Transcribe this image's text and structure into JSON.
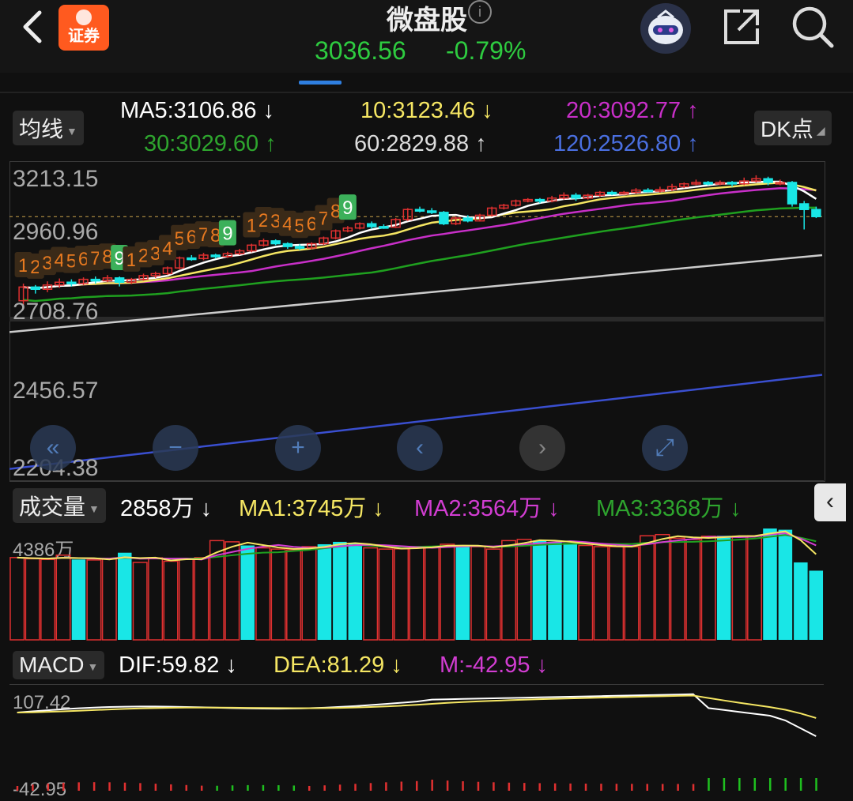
{
  "header": {
    "title": "微盘股",
    "price": "3036.56",
    "change_pct": "-0.79%",
    "logo_text": "证券"
  },
  "ma_chip": "均线",
  "dk_chip": "DK点",
  "ma": {
    "ma5": "MA5:3106.86 ↓",
    "ma10": "10:3123.46 ↓",
    "ma20": "20:3092.77 ↑",
    "ma30": "30:3029.60 ↑",
    "ma60": "60:2829.88 ↑",
    "ma120": "120:2526.80 ↑"
  },
  "yaxis": [
    "3213.15",
    "2960.96",
    "2708.76",
    "2456.57",
    "2204.38"
  ],
  "volume": {
    "chip": "成交量",
    "value": "2858万 ↓",
    "ma1": "MA1:3745万 ↓",
    "ma2": "MA2:3564万 ↓",
    "ma3": "MA3:3368万 ↓",
    "ymax": "4386万"
  },
  "macd": {
    "chip": "MACD",
    "dif": "DIF:59.82 ↓",
    "dea": "DEA:81.29 ↓",
    "m": "M:-42.95 ↓",
    "ymax": "107.42",
    "ymin": "-42.95"
  },
  "colors": {
    "up": "#e03030",
    "down": "#19e6e6",
    "ma5": "#ffffff",
    "ma10": "#f5e663",
    "ma20": "#c82fc8",
    "ma30": "#1fa01f",
    "ma60": "#cccccc",
    "ma120": "#3a4fd0",
    "td_up": "#e87a20",
    "td_down": "#3cb05a"
  },
  "candles": [
    [
      2790,
      2838,
      2775,
      2850
    ],
    [
      2838,
      2830,
      2815,
      2845
    ],
    [
      2830,
      2845,
      2820,
      2858
    ],
    [
      2845,
      2855,
      2835,
      2868
    ],
    [
      2855,
      2850,
      2840,
      2865
    ],
    [
      2850,
      2865,
      2845,
      2872
    ],
    [
      2865,
      2860,
      2850,
      2875
    ],
    [
      2860,
      2870,
      2855,
      2880
    ],
    [
      2870,
      2855,
      2840,
      2875
    ],
    [
      2855,
      2865,
      2848,
      2870
    ],
    [
      2865,
      2878,
      2860,
      2885
    ],
    [
      2878,
      2885,
      2870,
      2892
    ],
    [
      2885,
      2905,
      2880,
      2910
    ],
    [
      2905,
      2940,
      2900,
      2945
    ],
    [
      2940,
      2938,
      2930,
      2950
    ],
    [
      2938,
      2950,
      2932,
      2958
    ],
    [
      2950,
      2945,
      2938,
      2955
    ],
    [
      2945,
      2955,
      2940,
      2962
    ],
    [
      2955,
      2965,
      2950,
      2972
    ],
    [
      2965,
      2985,
      2960,
      2990
    ],
    [
      2985,
      3000,
      2980,
      3008
    ],
    [
      3000,
      2990,
      2985,
      3005
    ],
    [
      2990,
      2980,
      2972,
      2995
    ],
    [
      2980,
      2975,
      2968,
      2988
    ],
    [
      2975,
      2990,
      2970,
      2995
    ],
    [
      2990,
      3010,
      2985,
      3015
    ],
    [
      3010,
      3035,
      3005,
      3040
    ],
    [
      3035,
      3045,
      3030,
      3052
    ],
    [
      3045,
      3060,
      3040,
      3065
    ],
    [
      3060,
      3050,
      3042,
      3068
    ],
    [
      3050,
      3048,
      3042,
      3058
    ],
    [
      3048,
      3075,
      3045,
      3080
    ],
    [
      3075,
      3110,
      3070,
      3115
    ],
    [
      3110,
      3105,
      3100,
      3120
    ],
    [
      3105,
      3100,
      3094,
      3115
    ],
    [
      3100,
      3060,
      3055,
      3105
    ],
    [
      3060,
      3080,
      3055,
      3085
    ],
    [
      3080,
      3070,
      3065,
      3090
    ],
    [
      3070,
      3090,
      3068,
      3095
    ],
    [
      3090,
      3115,
      3085,
      3120
    ],
    [
      3115,
      3125,
      3110,
      3130
    ],
    [
      3125,
      3140,
      3120,
      3145
    ],
    [
      3140,
      3145,
      3135,
      3150
    ],
    [
      3145,
      3140,
      3132,
      3150
    ],
    [
      3140,
      3150,
      3135,
      3158
    ],
    [
      3150,
      3160,
      3145,
      3170
    ],
    [
      3160,
      3150,
      3140,
      3168
    ],
    [
      3150,
      3160,
      3145,
      3165
    ],
    [
      3160,
      3170,
      3155,
      3175
    ],
    [
      3170,
      3165,
      3160,
      3176
    ],
    [
      3165,
      3170,
      3162,
      3175
    ],
    [
      3170,
      3178,
      3165,
      3185
    ],
    [
      3178,
      3175,
      3170,
      3185
    ],
    [
      3175,
      3180,
      3170,
      3190
    ],
    [
      3180,
      3190,
      3175,
      3200
    ],
    [
      3190,
      3200,
      3185,
      3205
    ],
    [
      3200,
      3205,
      3195,
      3215
    ],
    [
      3205,
      3200,
      3195,
      3210
    ],
    [
      3200,
      3205,
      3195,
      3212
    ],
    [
      3205,
      3200,
      3190,
      3210
    ],
    [
      3200,
      3210,
      3195,
      3222
    ],
    [
      3210,
      3218,
      3205,
      3230
    ],
    [
      3218,
      3205,
      3195,
      3225
    ],
    [
      3205,
      3205,
      3195,
      3215
    ],
    [
      3205,
      3130,
      3120,
      3210
    ],
    [
      3130,
      3110,
      3040,
      3140
    ],
    [
      3110,
      3085,
      3080,
      3120
    ]
  ],
  "td_labels": [
    {
      "i": 0,
      "n": "1",
      "t": "up"
    },
    {
      "i": 1,
      "n": "2",
      "t": "up"
    },
    {
      "i": 2,
      "n": "3",
      "t": "up"
    },
    {
      "i": 3,
      "n": "4",
      "t": "up"
    },
    {
      "i": 4,
      "n": "5",
      "t": "up"
    },
    {
      "i": 5,
      "n": "6",
      "t": "up"
    },
    {
      "i": 6,
      "n": "7",
      "t": "up"
    },
    {
      "i": 7,
      "n": "8",
      "t": "up"
    },
    {
      "i": 8,
      "n": "9",
      "t": "dn"
    },
    {
      "i": 9,
      "n": "1",
      "t": "up"
    },
    {
      "i": 10,
      "n": "2",
      "t": "up"
    },
    {
      "i": 11,
      "n": "3",
      "t": "up"
    },
    {
      "i": 12,
      "n": "4",
      "t": "up"
    },
    {
      "i": 13,
      "n": "5",
      "t": "up"
    },
    {
      "i": 14,
      "n": "6",
      "t": "up"
    },
    {
      "i": 15,
      "n": "7",
      "t": "up"
    },
    {
      "i": 16,
      "n": "8",
      "t": "up"
    },
    {
      "i": 17,
      "n": "9",
      "t": "dn"
    },
    {
      "i": 19,
      "n": "1",
      "t": "up"
    },
    {
      "i": 20,
      "n": "2",
      "t": "up"
    },
    {
      "i": 21,
      "n": "3",
      "t": "up"
    },
    {
      "i": 22,
      "n": "4",
      "t": "up"
    },
    {
      "i": 23,
      "n": "5",
      "t": "up"
    },
    {
      "i": 24,
      "n": "6",
      "t": "up"
    },
    {
      "i": 25,
      "n": "7",
      "t": "up"
    },
    {
      "i": 26,
      "n": "8",
      "t": "up"
    },
    {
      "i": 27,
      "n": "9",
      "t": "dn"
    }
  ],
  "volumes": [
    [
      3400,
      1
    ],
    [
      3350,
      1
    ],
    [
      3320,
      1
    ],
    [
      3500,
      1
    ],
    [
      3320,
      0
    ],
    [
      3300,
      1
    ],
    [
      3340,
      1
    ],
    [
      3600,
      0
    ],
    [
      3200,
      1
    ],
    [
      3390,
      1
    ],
    [
      3250,
      1
    ],
    [
      3350,
      1
    ],
    [
      3400,
      1
    ],
    [
      4100,
      1
    ],
    [
      4050,
      1
    ],
    [
      3900,
      0
    ],
    [
      3800,
      1
    ],
    [
      3750,
      1
    ],
    [
      3720,
      1
    ],
    [
      3850,
      1
    ],
    [
      3950,
      0
    ],
    [
      4050,
      0
    ],
    [
      4000,
      0
    ],
    [
      3800,
      1
    ],
    [
      3750,
      1
    ],
    [
      3760,
      1
    ],
    [
      3850,
      1
    ],
    [
      3860,
      1
    ],
    [
      3950,
      1
    ],
    [
      3880,
      0
    ],
    [
      3850,
      1
    ],
    [
      3750,
      1
    ],
    [
      4100,
      1
    ],
    [
      4150,
      1
    ],
    [
      4100,
      0
    ],
    [
      4050,
      0
    ],
    [
      4000,
      0
    ],
    [
      3900,
      1
    ],
    [
      3850,
      1
    ],
    [
      3850,
      1
    ],
    [
      3850,
      1
    ],
    [
      4300,
      1
    ],
    [
      4350,
      1
    ],
    [
      4200,
      1
    ],
    [
      4150,
      1
    ],
    [
      4280,
      1
    ],
    [
      4300,
      0
    ],
    [
      4280,
      1
    ],
    [
      4300,
      1
    ],
    [
      4600,
      0
    ],
    [
      4550,
      0
    ],
    [
      3200,
      0
    ],
    [
      2858,
      0
    ]
  ]
}
